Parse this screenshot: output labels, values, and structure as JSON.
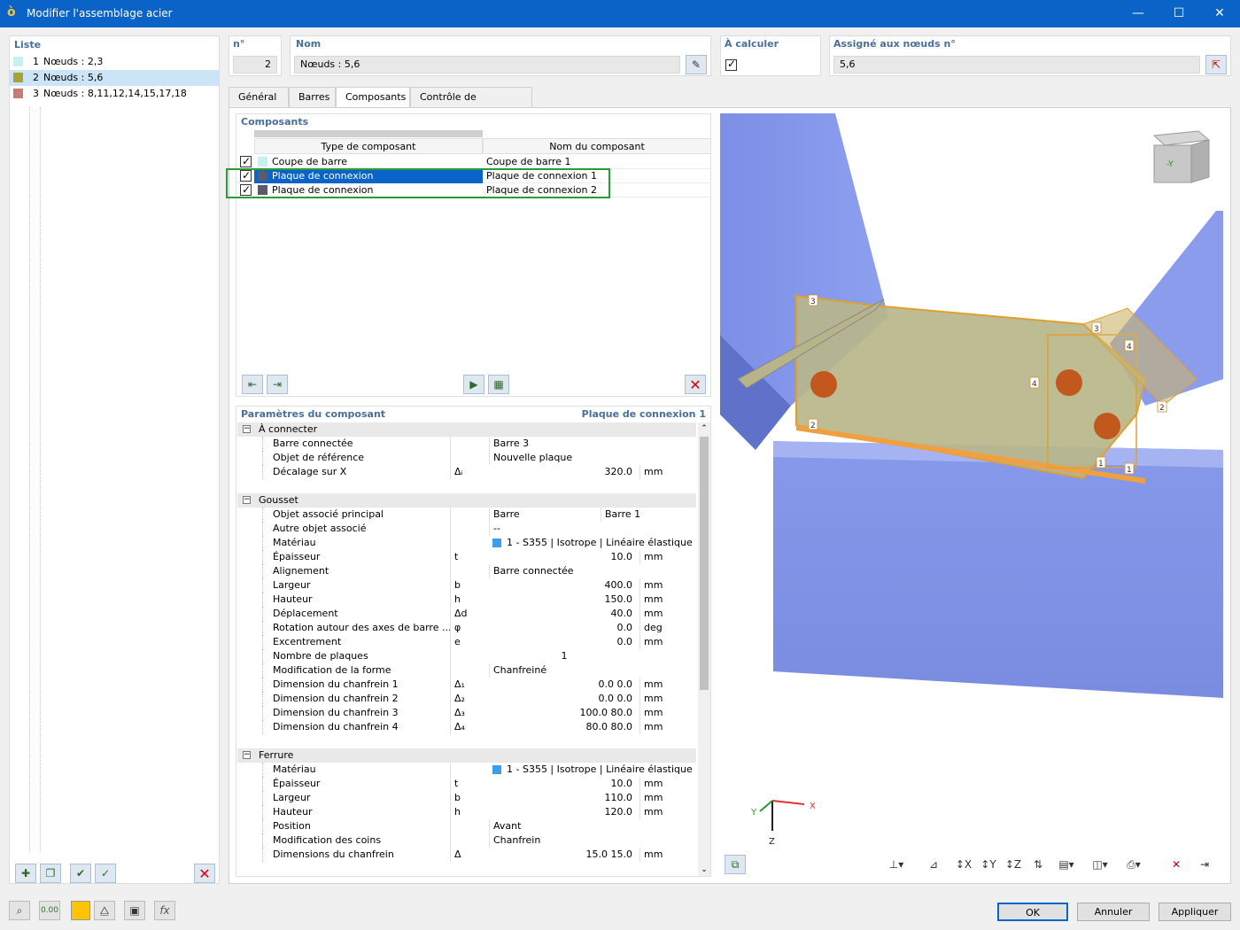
{
  "window": {
    "title": "Modifier l'assemblage acier",
    "minimize": "—",
    "maximize": "☐",
    "close": "✕"
  },
  "list": {
    "header": "Liste",
    "items": [
      {
        "num": "1",
        "label": "Nœuds : 2,3",
        "color": "#c6f1f3"
      },
      {
        "num": "2",
        "label": "Nœuds : 5,6",
        "color": "#a8a23a"
      },
      {
        "num": "3",
        "label": "Nœuds : 8,11,12,14,15,17,18",
        "color": "#c97a76"
      }
    ]
  },
  "top": {
    "no_label": "n°",
    "no_value": "2",
    "name_label": "Nom",
    "name_value": "Nœuds : 5,6",
    "calc_label": "À calculer",
    "assigned_label": "Assigné aux nœuds n°",
    "assigned_value": "5,6"
  },
  "tabs": [
    "Général",
    "Barres",
    "Composants",
    "Contrôle de plausibilité"
  ],
  "components": {
    "header": "Composants",
    "col_type": "Type de composant",
    "col_name": "Nom du composant",
    "rows": [
      {
        "type": "Coupe de barre",
        "name": "Coupe de barre 1",
        "color": "#c6f1f3"
      },
      {
        "type": "Plaque de connexion",
        "name": "Plaque de connexion 1",
        "color": "#5a5a6a"
      },
      {
        "type": "Plaque de connexion",
        "name": "Plaque de connexion 2",
        "color": "#5a5a6a"
      }
    ]
  },
  "params": {
    "header": "Paramètres du composant",
    "subject": "Plaque de connexion 1",
    "groups": [
      {
        "title": "À connecter",
        "rows": [
          {
            "name": "Barre connectée",
            "sym": "",
            "val": "Barre 3",
            "num": "",
            "unit": ""
          },
          {
            "name": "Objet de référence",
            "sym": "",
            "val": "Nouvelle plaque",
            "num": "",
            "unit": ""
          },
          {
            "name": "Décalage sur X",
            "sym": "Δᵢ",
            "val": "",
            "num": "320.0",
            "unit": "mm"
          }
        ]
      },
      {
        "title": "Gousset",
        "rows": [
          {
            "name": "Objet associé principal",
            "sym": "",
            "val": "Barre",
            "val2": "Barre 1",
            "num": "",
            "unit": ""
          },
          {
            "name": "Autre objet associé",
            "sym": "",
            "val": "--",
            "num": "",
            "unit": ""
          },
          {
            "name": "Matériau",
            "sym": "",
            "val": "1 - S355 | Isotrope | Linéaire élastique",
            "swatch": true,
            "num": "",
            "unit": ""
          },
          {
            "name": "Épaisseur",
            "sym": "t",
            "val": "",
            "num": "10.0",
            "unit": "mm"
          },
          {
            "name": "Alignement",
            "sym": "",
            "val": "Barre connectée",
            "num": "",
            "unit": ""
          },
          {
            "name": "Largeur",
            "sym": "b",
            "val": "",
            "num": "400.0",
            "unit": "mm"
          },
          {
            "name": "Hauteur",
            "sym": "h",
            "val": "",
            "num": "150.0",
            "unit": "mm"
          },
          {
            "name": "Déplacement",
            "sym": "Δd",
            "val": "",
            "num": "40.0",
            "unit": "mm"
          },
          {
            "name": "Rotation autour des axes de barre ...",
            "sym": "φ",
            "val": "",
            "num": "0.0",
            "unit": "deg"
          },
          {
            "name": "Excentrement",
            "sym": "e",
            "val": "",
            "num": "0.0",
            "unit": "mm"
          },
          {
            "name": "Nombre de plaques",
            "sym": "",
            "val": "",
            "center": "1",
            "num": "",
            "unit": ""
          },
          {
            "name": "Modification de la forme",
            "sym": "",
            "val": "Chanfreiné",
            "num": "",
            "unit": ""
          },
          {
            "name": "Dimension du chanfrein 1",
            "sym": "Δ₁",
            "val": "",
            "num": "0.0 0.0",
            "unit": "mm"
          },
          {
            "name": "Dimension du chanfrein 2",
            "sym": "Δ₂",
            "val": "",
            "num": "0.0 0.0",
            "unit": "mm"
          },
          {
            "name": "Dimension du chanfrein 3",
            "sym": "Δ₃",
            "val": "",
            "num": "100.0 80.0",
            "unit": "mm"
          },
          {
            "name": "Dimension du chanfrein 4",
            "sym": "Δ₄",
            "val": "",
            "num": "80.0 80.0",
            "unit": "mm"
          }
        ]
      },
      {
        "title": "Ferrure",
        "rows": [
          {
            "name": "Matériau",
            "sym": "",
            "val": "1 - S355 | Isotrope | Linéaire élastique",
            "swatch": true,
            "num": "",
            "unit": ""
          },
          {
            "name": "Épaisseur",
            "sym": "t",
            "val": "",
            "num": "10.0",
            "unit": "mm"
          },
          {
            "name": "Largeur",
            "sym": "b",
            "val": "",
            "num": "110.0",
            "unit": "mm"
          },
          {
            "name": "Hauteur",
            "sym": "h",
            "val": "",
            "num": "120.0",
            "unit": "mm"
          },
          {
            "name": "Position",
            "sym": "",
            "val": "Avant",
            "num": "",
            "unit": ""
          },
          {
            "name": "Modification des coins",
            "sym": "",
            "val": "Chanfrein",
            "num": "",
            "unit": ""
          },
          {
            "name": "Dimensions du chanfrein",
            "sym": "Δ",
            "val": "",
            "num": "15.0 15.0",
            "unit": "mm"
          }
        ]
      }
    ]
  },
  "view": {
    "axis_x": "X",
    "axis_y": "Y",
    "axis_z": "Z",
    "labels": [
      "1",
      "1",
      "2",
      "2",
      "3",
      "3",
      "4",
      "4"
    ],
    "cube_label": "-Y"
  },
  "buttons": {
    "ok": "OK",
    "cancel": "Annuler",
    "apply": "Appliquer"
  },
  "footer_icons": [
    "search-icon",
    "units-icon",
    "color-icon",
    "model-icon",
    "view-icon",
    "formula-icon"
  ],
  "footer": {
    "units": "0.00",
    "formula": "fx"
  }
}
